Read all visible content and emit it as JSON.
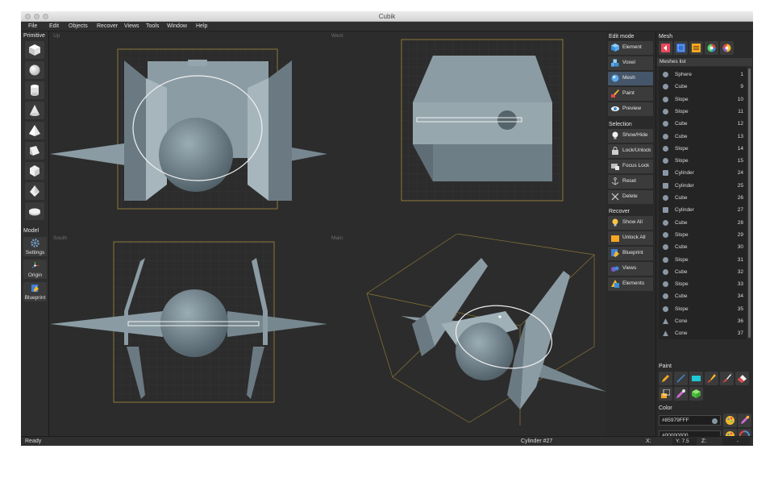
{
  "window": {
    "title": "Cubik"
  },
  "menu": [
    "File",
    "Edit",
    "Objects",
    "Recover",
    "Views",
    "Tools",
    "Window",
    "Help"
  ],
  "left_panel": {
    "primitive_label": "Primitive",
    "primitives": [
      "cube-icon",
      "sphere-icon",
      "cylinder-icon",
      "cone-icon",
      "pyramid-icon",
      "slope-icon",
      "hexagon-icon",
      "octahedron-icon",
      "disc-icon"
    ],
    "model_label": "Model",
    "tools": [
      {
        "label": "Settings",
        "icon": "gear-icon"
      },
      {
        "label": "Origin",
        "icon": "origin-icon"
      },
      {
        "label": "Blueprint",
        "icon": "blueprint-icon"
      }
    ]
  },
  "viewports": [
    {
      "label": "Up"
    },
    {
      "label": "West"
    },
    {
      "label": "South"
    },
    {
      "label": "Main"
    }
  ],
  "edit_mode": {
    "label": "Edit mode",
    "buttons": [
      {
        "label": "Element",
        "icon": "element-icon"
      },
      {
        "label": "Voxel",
        "icon": "voxel-icon"
      },
      {
        "label": "Mesh",
        "icon": "mesh-icon",
        "active": true
      },
      {
        "label": "Paint",
        "icon": "paint-icon"
      },
      {
        "label": "Preview",
        "icon": "eye-icon"
      }
    ]
  },
  "selection": {
    "label": "Selection",
    "buttons": [
      {
        "label": "Show/Hide",
        "icon": "bulb-icon"
      },
      {
        "label": "Lock/Unlock",
        "icon": "lock-icon"
      },
      {
        "label": "Focus Lock",
        "icon": "focus-lock-icon"
      },
      {
        "label": "Reset",
        "icon": "anchor-icon"
      },
      {
        "label": "Delete",
        "icon": "delete-icon"
      }
    ]
  },
  "recover": {
    "label": "Recover",
    "buttons": [
      {
        "label": "Show All",
        "icon": "bulb-icon"
      },
      {
        "label": "Unlock All",
        "icon": "unlock-icon"
      },
      {
        "label": "Blueprint",
        "icon": "blueprint-icon"
      },
      {
        "label": "Views",
        "icon": "views-icon"
      },
      {
        "label": "Elements",
        "icon": "elements-icon"
      }
    ]
  },
  "mesh_panel": {
    "label": "Mesh",
    "meshes_list_label": "Meshes list",
    "items": [
      {
        "name": "Sphere",
        "id": "1"
      },
      {
        "name": "Cube",
        "id": "9"
      },
      {
        "name": "Slope",
        "id": "10"
      },
      {
        "name": "Slope",
        "id": "11"
      },
      {
        "name": "Cube",
        "id": "12"
      },
      {
        "name": "Cube",
        "id": "13"
      },
      {
        "name": "Slope",
        "id": "14"
      },
      {
        "name": "Slope",
        "id": "15"
      },
      {
        "name": "Cylinder",
        "id": "24"
      },
      {
        "name": "Cylinder",
        "id": "25"
      },
      {
        "name": "Cube",
        "id": "26"
      },
      {
        "name": "Cylinder",
        "id": "27"
      },
      {
        "name": "Cube",
        "id": "28"
      },
      {
        "name": "Slope",
        "id": "29"
      },
      {
        "name": "Cube",
        "id": "30"
      },
      {
        "name": "Slope",
        "id": "31"
      },
      {
        "name": "Cube",
        "id": "32"
      },
      {
        "name": "Slope",
        "id": "33"
      },
      {
        "name": "Cube",
        "id": "34"
      },
      {
        "name": "Slope",
        "id": "35"
      },
      {
        "name": "Cone",
        "id": "36"
      },
      {
        "name": "Cone",
        "id": "37"
      }
    ]
  },
  "paint": {
    "label": "Paint"
  },
  "color": {
    "label": "Color",
    "primary": "#85979FFF",
    "secondary": "#00000000"
  },
  "status": {
    "ready": "Ready",
    "selection": "Cylinder #27",
    "x_label": "X:",
    "y_label": "Y: 7.5",
    "z_label": "Z:",
    "z_value": "-"
  },
  "colors": {
    "accent": "#4a90d9",
    "model_gray": "#85979f",
    "bbox": "#a68a3c"
  }
}
